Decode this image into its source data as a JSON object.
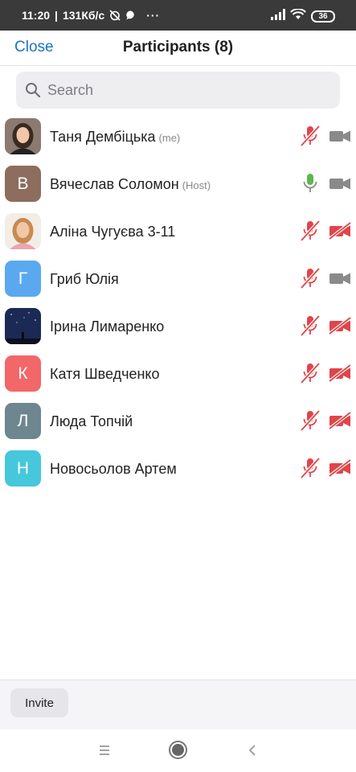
{
  "status_bar": {
    "time": "11:20",
    "network_speed": "131Кб/с",
    "more_dots": "···",
    "battery": "36",
    "icons": [
      "alarm-off-icon",
      "chat-bubble-icon",
      "signal-icon",
      "wifi-icon",
      "battery-icon"
    ]
  },
  "header": {
    "close_label": "Close",
    "title": "Participants (8)"
  },
  "search": {
    "placeholder": "Search",
    "value": ""
  },
  "participants": [
    {
      "name": "Таня Дембіцька",
      "tag": "(me)",
      "avatar_type": "photo",
      "avatar_letter": "",
      "avatar_color": "#5a4a40",
      "mic": "muted",
      "camera": "on"
    },
    {
      "name": "Вячеслав Соломон",
      "tag": "(Host)",
      "avatar_type": "letter",
      "avatar_letter": "В",
      "avatar_color": "#8c6d5e",
      "mic": "active",
      "camera": "on"
    },
    {
      "name": "Аліна Чугуєва 3-11",
      "tag": "",
      "avatar_type": "photo",
      "avatar_letter": "",
      "avatar_color": "#d8a080",
      "mic": "muted",
      "camera": "off"
    },
    {
      "name": "Гриб Юлія",
      "tag": "",
      "avatar_type": "letter",
      "avatar_letter": "Г",
      "avatar_color": "#5aa9f0",
      "mic": "muted",
      "camera": "on"
    },
    {
      "name": "Ірина Лимаренко",
      "tag": "",
      "avatar_type": "photo",
      "avatar_letter": "",
      "avatar_color": "#1b2a55",
      "mic": "muted",
      "camera": "off"
    },
    {
      "name": "Катя Шведченко",
      "tag": "",
      "avatar_type": "letter",
      "avatar_letter": "К",
      "avatar_color": "#f26768",
      "mic": "muted",
      "camera": "off"
    },
    {
      "name": "Люда Топчій",
      "tag": "",
      "avatar_type": "letter",
      "avatar_letter": "Л",
      "avatar_color": "#6e8690",
      "mic": "muted",
      "camera": "off"
    },
    {
      "name": "Новосьолов Артем",
      "tag": "",
      "avatar_type": "letter",
      "avatar_letter": "Н",
      "avatar_color": "#46c7dc",
      "mic": "muted",
      "camera": "off"
    }
  ],
  "footer": {
    "invite_label": "Invite"
  },
  "colors": {
    "accent": "#1a73c8",
    "muted_red": "#e0454a",
    "active_green": "#5cb94a",
    "camera_gray": "#8a8a8a"
  }
}
